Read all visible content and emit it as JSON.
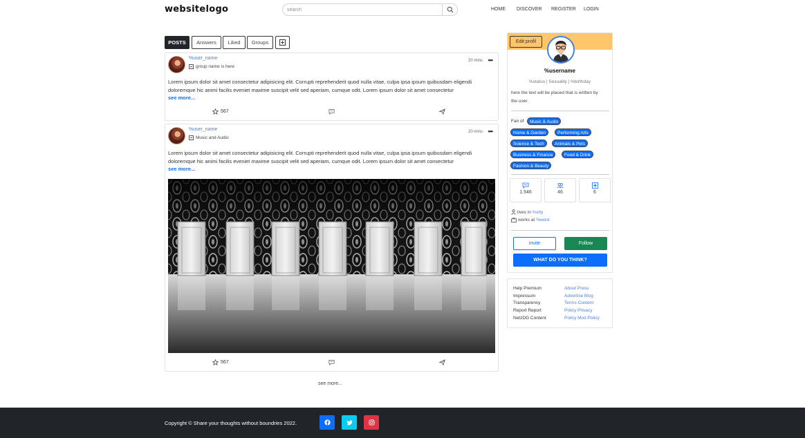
{
  "header": {
    "logo": "websitelogo",
    "search_placeholder": "search",
    "nav": [
      "HOME",
      "DISCOVER",
      "REGISTER",
      "LOGIN"
    ]
  },
  "tabs": [
    "POSTS",
    "Answers",
    "Liked",
    "Groups"
  ],
  "posts": [
    {
      "username": "%user_name",
      "group": "group name is here",
      "time": "20 mins",
      "text": "Lorem ipsum dolor sit amet consectetur adipisicing elit. Corrupti reprehenderit quod nulla vitae, culpa ipsa ipsum quibusdam eligendi doloremque hic animi facilis eveniet maxime suscipit velit sed aperiam, cumque odit. Lorem ipsum dolor sit amet consectetur",
      "see_more": "see more...",
      "likes": "567"
    },
    {
      "username": "%user_name",
      "group": "Music and Audio",
      "time": "20 mins",
      "text": "Lorem ipsum dolor sit amet consectetur adipisicing elit. Corrupti reprehenderit quod nulla vitae, culpa ipsa ipsum quibusdam eligendi doloremque hic animi facilis eveniet maxime suscipit velit sed aperiam, cumque odit. Lorem ipsum dolor sit amet consectetur",
      "see_more": "see more...",
      "likes": "567"
    }
  ],
  "feed_see_more": "see more...",
  "profile": {
    "edit_label": "Edit profil",
    "username": "%username",
    "meta": "%status | Sexuality | %birthday",
    "bio": "here the text will be placed that is written by the user.",
    "fan_of_label": "Fan of",
    "interests": [
      "Music & Audio",
      "Home & Garden",
      "Performing Arts",
      "Science & Tech",
      "Animals & Pets",
      "Business & Finance",
      "Food & Drink",
      "Fashion & Beauty"
    ],
    "stats": [
      "1.546",
      "46",
      "6"
    ],
    "lives_in_label": "lives in",
    "city": "%city",
    "works_at_label": "works at",
    "work": "%work",
    "invite_label": "invite",
    "follow_label": "Follow",
    "wdyt_label": "WHAT DO YOU THINK?"
  },
  "footer_links": {
    "left": [
      "Help Premium",
      "Impressum",
      "Transparency",
      "Report Report",
      "NetzDG Content"
    ],
    "right": [
      "About Press",
      "Advertise Blog",
      "Terms Content",
      "Policy Privacy",
      "Policy Mod Policy"
    ]
  },
  "footer": {
    "copyright": "Copyright © Share your thoughts without boundries 2022."
  },
  "colors": {
    "primary": "#0d6efd",
    "follow": "#198754",
    "profile_band": "#ffc56b",
    "footer_bg": "#212529",
    "facebook": "#0d6efd",
    "twitter": "#0dcaf0",
    "instagram": "#dc3545"
  },
  "icons": [
    "search-icon",
    "group-icon",
    "more-icon",
    "star-icon",
    "comment-icon",
    "send-icon",
    "add-square-icon",
    "chat-icon",
    "people-icon",
    "plus-square-icon",
    "person-icon",
    "briefcase-icon",
    "facebook-icon",
    "twitter-icon",
    "instagram-icon"
  ]
}
